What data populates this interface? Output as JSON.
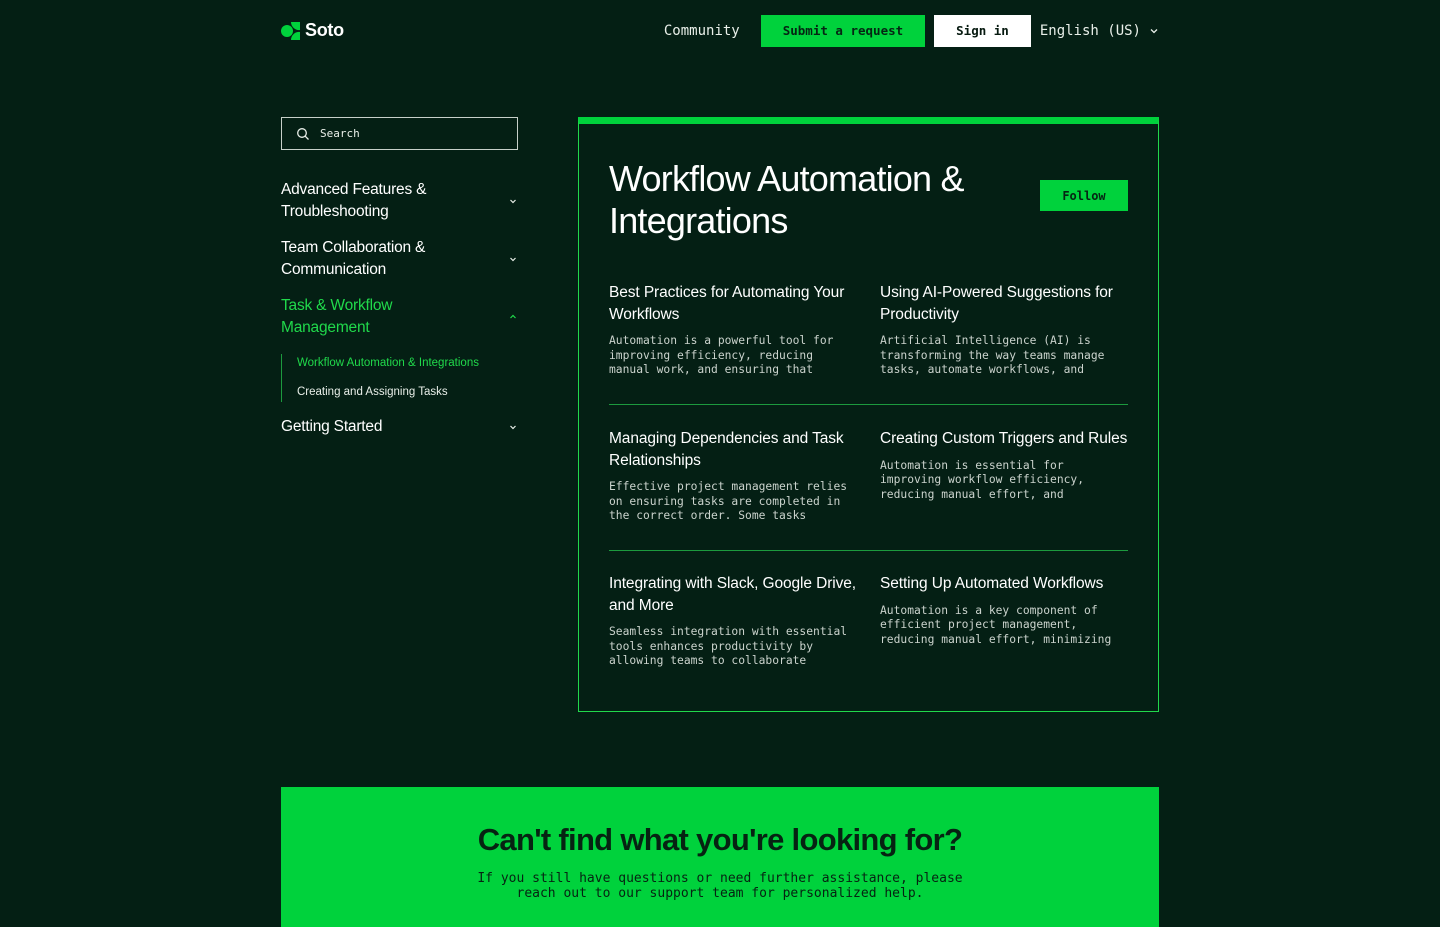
{
  "header": {
    "logo_text": "Soto",
    "community": "Community",
    "submit_request": "Submit a request",
    "sign_in": "Sign in",
    "language": "English (US)"
  },
  "colors": {
    "background": "#041f14",
    "accent": "#00d23c",
    "accent_text": "#20d94b"
  },
  "sidebar": {
    "search_placeholder": "Search",
    "groups": [
      {
        "label": "Advanced Features & Troubleshooting",
        "expanded": false
      },
      {
        "label": "Team Collaboration & Communication",
        "expanded": false
      },
      {
        "label": "Task & Workflow Management",
        "expanded": true
      },
      {
        "label": "Getting Started",
        "expanded": false
      }
    ],
    "sub_items": [
      {
        "label": "Workflow Automation & Integrations",
        "active": true
      },
      {
        "label": "Creating and Assigning Tasks",
        "active": false
      }
    ]
  },
  "main": {
    "title": "Workflow Automation & Integrations",
    "follow": "Follow",
    "articles": [
      {
        "title": "Best Practices for Automating Your Workflows",
        "desc": "Automation is a powerful tool for improving efficiency, reducing manual work, and ensuring that"
      },
      {
        "title": "Using AI-Powered Suggestions for Productivity",
        "desc": "Artificial Intelligence (AI) is transforming the way teams manage tasks, automate workflows, and"
      },
      {
        "title": "Managing Dependencies and Task Relationships",
        "desc": "Effective project management relies on ensuring tasks are completed in the correct order. Some tasks"
      },
      {
        "title": "Creating Custom Triggers and Rules",
        "desc": "Automation is essential for improving workflow efficiency, reducing manual effort, and"
      },
      {
        "title": "Integrating with Slack, Google Drive, and More",
        "desc": "Seamless integration with essential tools enhances productivity by allowing teams to collaborate"
      },
      {
        "title": "Setting Up Automated Workflows",
        "desc": "Automation is a key component of efficient project management, reducing manual effort, minimizing"
      }
    ]
  },
  "banner": {
    "title": "Can't find what you're looking for?",
    "text": "If you still have questions or need further assistance, please reach out to our support team for personalized help."
  }
}
